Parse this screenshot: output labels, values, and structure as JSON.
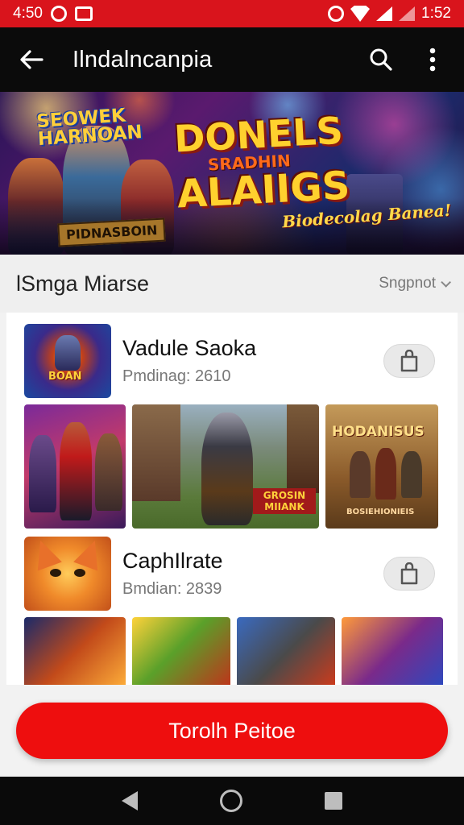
{
  "status_bar": {
    "time": "4:50",
    "clock": "1:52",
    "icons": [
      "notification-circle-icon",
      "media-box-icon",
      "alarm-icon",
      "wifi-icon",
      "signal-icon",
      "signal-dim-icon"
    ]
  },
  "app_bar": {
    "title": "Ilndalncanpia",
    "back_icon": "back-arrow-icon",
    "search_icon": "search-icon",
    "menu_icon": "more-vert-icon"
  },
  "banner": {
    "small_title": "SEOWEK HARNOAN",
    "main_title_line1": "DONELS",
    "main_title_line2": "SRADHIN",
    "main_title_line3": "ALAIIGS",
    "tagline": "Biodecolag Banea!",
    "plate": "PIDNASBOIN"
  },
  "section": {
    "heading": "lSmga Miarse",
    "sort_label": "Sngpnot"
  },
  "apps": [
    {
      "name": "Vadule Saoka",
      "meta": "Pmdinag:  2610",
      "icon_label": "BOAN",
      "screenshots": [
        {
          "label": ""
        },
        {
          "label": "GROSIN MIIANK"
        },
        {
          "label": "HODANISUS",
          "sublabel": "BOSIEHIONIEIS"
        }
      ]
    },
    {
      "name": "CaphIlrate",
      "meta": "Bmdian:  2839",
      "icon_label": "",
      "screenshots": [
        {
          "label": ""
        },
        {
          "label": ""
        },
        {
          "label": ""
        },
        {
          "label": ""
        }
      ]
    }
  ],
  "cta": {
    "label": "Torolh Peitoe"
  },
  "colors": {
    "status_red": "#d9141c",
    "accent_red": "#ee0e0e",
    "app_bar_bg": "#0b0b0b"
  }
}
